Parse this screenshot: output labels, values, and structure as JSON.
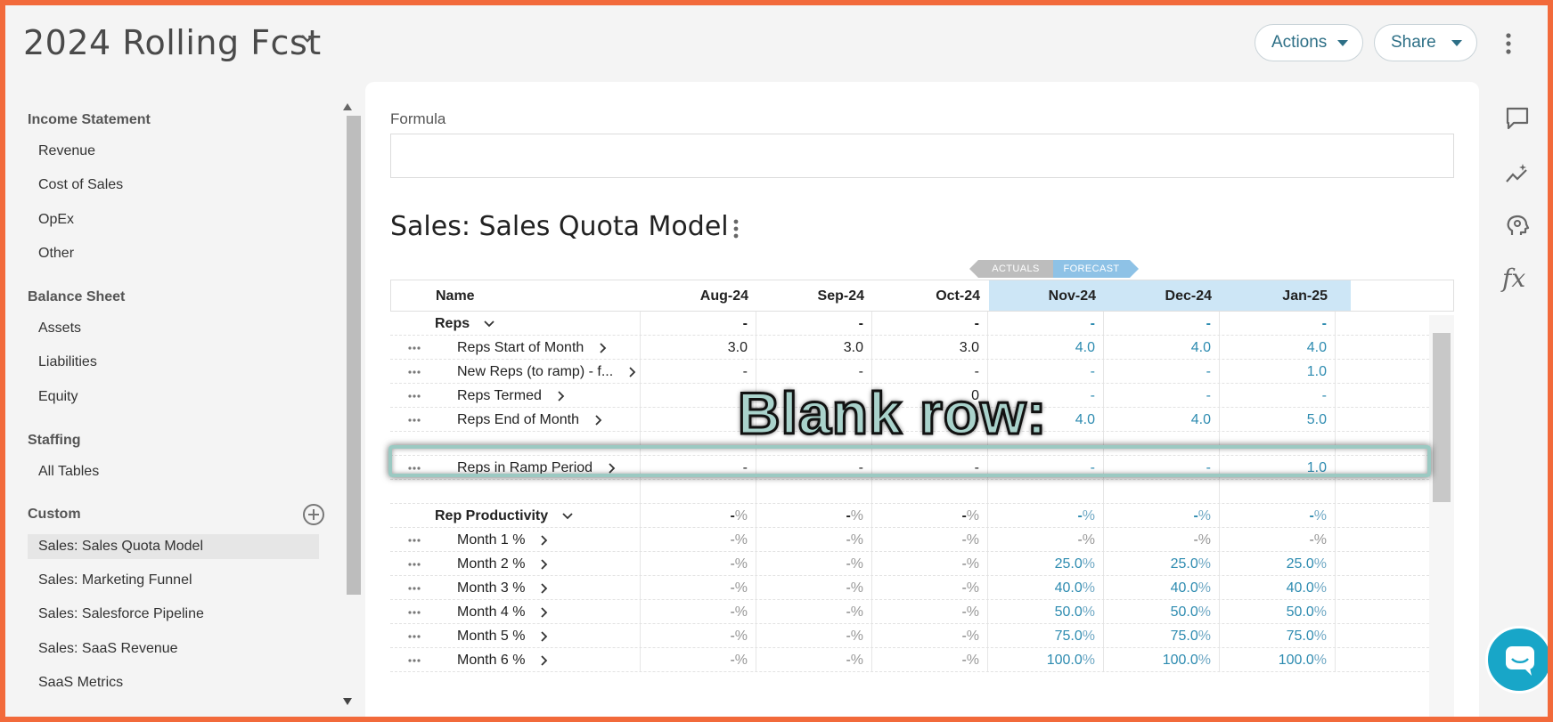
{
  "header": {
    "title": "2024 Rolling Fcst",
    "actions_label": "Actions",
    "share_label": "Share"
  },
  "sidebar": {
    "sections": [
      {
        "label": "Income Statement",
        "items": [
          "Revenue",
          "Cost of Sales",
          "OpEx",
          "Other"
        ]
      },
      {
        "label": "Balance Sheet",
        "items": [
          "Assets",
          "Liabilities",
          "Equity"
        ]
      },
      {
        "label": "Staffing",
        "items": [
          "All Tables"
        ]
      },
      {
        "label": "Custom",
        "items": [
          "Sales: Sales Quota Model",
          "Sales: Marketing Funnel",
          "Sales: Salesforce Pipeline",
          "Sales: SaaS Revenue",
          "SaaS Metrics"
        ]
      }
    ],
    "active_item": "Sales: Sales Quota Model"
  },
  "main": {
    "formula_label": "Formula",
    "formula_value": "",
    "section_title": "Sales: Sales Quota Model",
    "tags": {
      "actuals": "ACTUALS",
      "forecast": "FORECAST"
    },
    "columns": {
      "name": "Name",
      "months": [
        "Aug-24",
        "Sep-24",
        "Oct-24",
        "Nov-24",
        "Dec-24",
        "Jan-25"
      ],
      "forecast_start_index": 3
    },
    "rows": [
      {
        "name": "Reps",
        "bold": true,
        "chevron": "down",
        "dots": false,
        "values": [
          "-",
          "-",
          "-",
          "-",
          "-",
          "-"
        ]
      },
      {
        "name": "Reps Start of Month",
        "bold": false,
        "chevron": "right",
        "dots": true,
        "values": [
          "3.0",
          "3.0",
          "3.0",
          "4.0",
          "4.0",
          "4.0"
        ]
      },
      {
        "name": "New Reps (to ramp) - f...",
        "bold": false,
        "chevron": "right",
        "dots": true,
        "values": [
          "-",
          "-",
          "-",
          "-",
          "-",
          "1.0"
        ]
      },
      {
        "name": "Reps Termed",
        "bold": false,
        "chevron": "right",
        "dots": true,
        "values": [
          "",
          "",
          "0",
          "-",
          "-",
          "-"
        ]
      },
      {
        "name": "Reps End of Month",
        "bold": false,
        "chevron": "right",
        "dots": true,
        "values": [
          "",
          "",
          "0",
          "4.0",
          "4.0",
          "5.0"
        ]
      },
      {
        "name": "",
        "bold": false,
        "chevron": "",
        "dots": false,
        "values": [
          "",
          "",
          "",
          "",
          "",
          ""
        ]
      },
      {
        "name": "Reps in Ramp Period",
        "bold": false,
        "chevron": "right",
        "dots": true,
        "values": [
          "-",
          "-",
          "-",
          "-",
          "-",
          "1.0"
        ]
      },
      {
        "name": "",
        "bold": false,
        "chevron": "",
        "dots": false,
        "values": [
          "",
          "",
          "",
          "",
          "",
          ""
        ]
      },
      {
        "name": "Rep Productivity",
        "bold": true,
        "chevron": "down",
        "dots": false,
        "pct": true,
        "values": [
          "-",
          "-",
          "-",
          "-",
          "-",
          "-"
        ]
      },
      {
        "name": "Month 1 %",
        "bold": false,
        "chevron": "right",
        "dots": true,
        "pct": true,
        "grey": true,
        "values": [
          "-",
          "-",
          "-",
          "-",
          "-",
          "-"
        ]
      },
      {
        "name": "Month 2 %",
        "bold": false,
        "chevron": "right",
        "dots": true,
        "pct": true,
        "grey": true,
        "values": [
          "-",
          "-",
          "-",
          "25.0",
          "25.0",
          "25.0"
        ]
      },
      {
        "name": "Month 3 %",
        "bold": false,
        "chevron": "right",
        "dots": true,
        "pct": true,
        "grey": true,
        "values": [
          "-",
          "-",
          "-",
          "40.0",
          "40.0",
          "40.0"
        ]
      },
      {
        "name": "Month 4 %",
        "bold": false,
        "chevron": "right",
        "dots": true,
        "pct": true,
        "grey": true,
        "values": [
          "-",
          "-",
          "-",
          "50.0",
          "50.0",
          "50.0"
        ]
      },
      {
        "name": "Month 5 %",
        "bold": false,
        "chevron": "right",
        "dots": true,
        "pct": true,
        "grey": true,
        "values": [
          "-",
          "-",
          "-",
          "75.0",
          "75.0",
          "75.0"
        ]
      },
      {
        "name": "Month 6 %",
        "bold": false,
        "chevron": "right",
        "dots": true,
        "pct": true,
        "grey": true,
        "values": [
          "-",
          "-",
          "-",
          "100.0",
          "100.0",
          "100.0"
        ]
      }
    ],
    "pct_unit": "%"
  },
  "overlay": {
    "label": "Blank row:"
  },
  "colors": {
    "accent": "#2d8bb0",
    "frame": "#f26a3b",
    "forecast_header": "#cde6f6",
    "chat": "#18a6c8"
  },
  "icons": [
    "chevron-down-icon",
    "kebab-icon",
    "add-circle-icon",
    "comment-icon",
    "insights-icon",
    "brain-icon",
    "fx-icon",
    "chat-icon"
  ]
}
